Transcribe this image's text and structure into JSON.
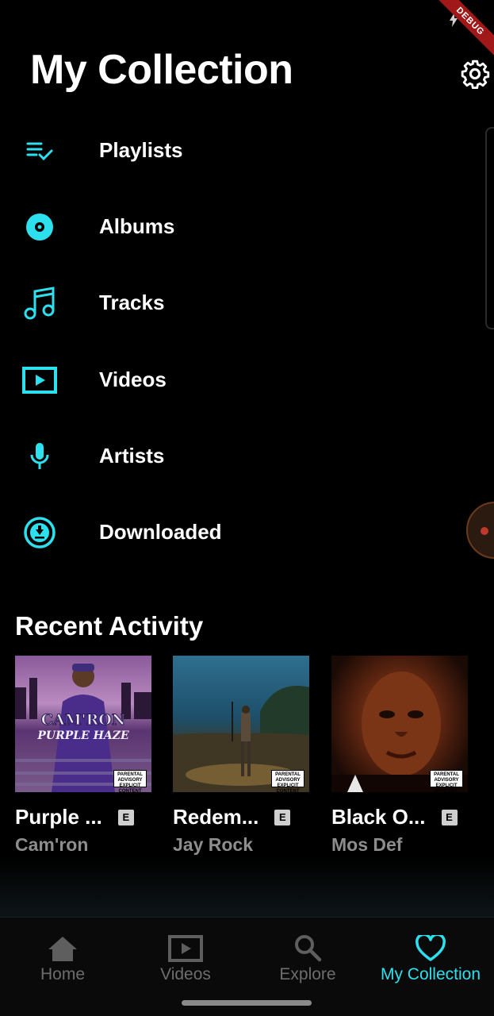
{
  "header": {
    "title": "My Collection",
    "debug_badge": "DEBUG"
  },
  "menu": [
    {
      "label": "Playlists",
      "icon": "playlist-check-icon"
    },
    {
      "label": "Albums",
      "icon": "album-disc-icon"
    },
    {
      "label": "Tracks",
      "icon": "music-note-icon"
    },
    {
      "label": "Videos",
      "icon": "video-play-icon"
    },
    {
      "label": "Artists",
      "icon": "microphone-icon"
    },
    {
      "label": "Downloaded",
      "icon": "download-circle-icon"
    }
  ],
  "recent": {
    "title": "Recent Activity",
    "items": [
      {
        "title": "Purple ...",
        "artist": "Cam'ron",
        "explicit": "E",
        "cover_text_1": "CAM'RON",
        "cover_text_2": "PURPLE HAZE",
        "advisory": "PARENTAL ADVISORY EXPLICIT CONTENT"
      },
      {
        "title": "Redem...",
        "artist": "Jay Rock",
        "explicit": "E",
        "advisory": "PARENTAL ADVISORY EXPLICIT CONTENT"
      },
      {
        "title": "Black O...",
        "artist": "Mos Def",
        "explicit": "E",
        "advisory": "PARENTAL ADVISORY EXPLICIT CONTENT"
      }
    ]
  },
  "nav": [
    {
      "label": "Home",
      "icon": "home-icon",
      "active": false
    },
    {
      "label": "Videos",
      "icon": "video-icon",
      "active": false
    },
    {
      "label": "Explore",
      "icon": "search-icon",
      "active": false
    },
    {
      "label": "My Collection",
      "icon": "heart-icon",
      "active": true
    }
  ],
  "colors": {
    "accent": "#2de0ee",
    "background": "#000000",
    "muted": "#8d8d8d"
  }
}
